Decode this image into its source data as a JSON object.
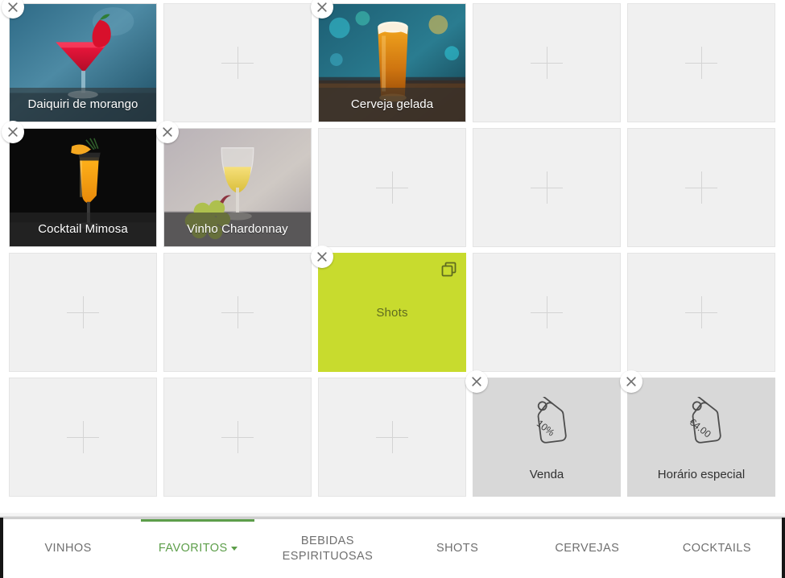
{
  "grid": {
    "columns": 5,
    "rows": 4,
    "cells": [
      {
        "kind": "product",
        "label": "Daiquiri de morango",
        "image": "strawberry-daiquiri",
        "removable": true
      },
      {
        "kind": "empty",
        "icon": "plus-icon",
        "removable": false
      },
      {
        "kind": "product",
        "label": "Cerveja gelada",
        "image": "cold-beer",
        "removable": true
      },
      {
        "kind": "empty",
        "icon": "plus-icon",
        "removable": false
      },
      {
        "kind": "empty",
        "icon": "plus-icon",
        "removable": false
      },
      {
        "kind": "product",
        "label": "Cocktail Mimosa",
        "image": "mimosa-cocktail",
        "removable": true
      },
      {
        "kind": "product",
        "label": "Vinho Chardonnay",
        "image": "chardonnay-wine",
        "removable": true
      },
      {
        "kind": "empty",
        "icon": "plus-icon",
        "removable": false
      },
      {
        "kind": "empty",
        "icon": "plus-icon",
        "removable": false
      },
      {
        "kind": "empty",
        "icon": "plus-icon",
        "removable": false
      },
      {
        "kind": "empty",
        "icon": "plus-icon",
        "removable": false
      },
      {
        "kind": "empty",
        "icon": "plus-icon",
        "removable": false
      },
      {
        "kind": "category",
        "label": "Shots",
        "color": "#c8db2e",
        "text_color": "#5f6b20",
        "icon": "duplicate-icon",
        "removable": true
      },
      {
        "kind": "empty",
        "icon": "plus-icon",
        "removable": false
      },
      {
        "kind": "empty",
        "icon": "plus-icon",
        "removable": false
      },
      {
        "kind": "empty",
        "icon": "plus-icon",
        "removable": false
      },
      {
        "kind": "empty",
        "icon": "plus-icon",
        "removable": false
      },
      {
        "kind": "empty",
        "icon": "plus-icon",
        "removable": false
      },
      {
        "kind": "promo",
        "label": "Venda",
        "tag_text": "10%",
        "icon": "price-tag-icon",
        "removable": true
      },
      {
        "kind": "promo",
        "label": "Horário especial",
        "tag_text": "€4.00",
        "icon": "price-tag-icon",
        "removable": true
      }
    ]
  },
  "bottom_nav": {
    "tabs": [
      {
        "label": "VINHOS",
        "active": false,
        "has_caret": false
      },
      {
        "label": "FAVORITOS",
        "active": true,
        "has_caret": true
      },
      {
        "label": "BEBIDAS ESPIRITUOSAS",
        "active": false,
        "has_caret": false
      },
      {
        "label": "SHOTS",
        "active": false,
        "has_caret": false
      },
      {
        "label": "CERVEJAS",
        "active": false,
        "has_caret": false
      },
      {
        "label": "COCKTAILS",
        "active": false,
        "has_caret": false
      }
    ]
  },
  "colors": {
    "accent_green": "#5d9e4a",
    "category_lime": "#c8db2e",
    "promo_gray": "#d8d8d8",
    "empty_tile": "#f0f0f0",
    "muted_text": "#6f6f6f"
  },
  "close_icon_name": "close-icon"
}
